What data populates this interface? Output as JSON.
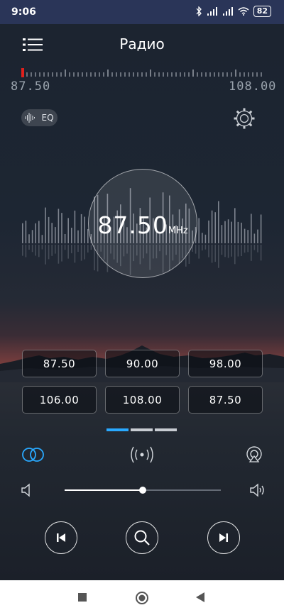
{
  "status_bar": {
    "time": "9:06",
    "battery": "82"
  },
  "header": {
    "title": "Радио"
  },
  "dial": {
    "min_label": "87.50",
    "max_label": "108.00"
  },
  "eq_button": {
    "label": "EQ"
  },
  "tuner": {
    "frequency": "87.50",
    "unit": "MHz"
  },
  "presets": [
    "87.50",
    "90.00",
    "98.00",
    "106.00",
    "108.00",
    "87.50"
  ],
  "pager": {
    "pages": 3,
    "active_index": 0
  },
  "volume": {
    "level": 0.5
  },
  "colors": {
    "accent": "#29a9ff",
    "status_bar": "#2a3558"
  },
  "icons": {
    "menu": "menu-icon",
    "eq": "equalizer-icon",
    "settings": "gear-icon",
    "stereo": "stereo-rings-icon",
    "broadcast": "broadcast-icon",
    "airplay": "airplay-icon",
    "volume_low": "volume-low-icon",
    "volume_high": "volume-high-icon",
    "previous": "skip-previous-icon",
    "search": "search-icon",
    "next": "skip-next-icon"
  }
}
